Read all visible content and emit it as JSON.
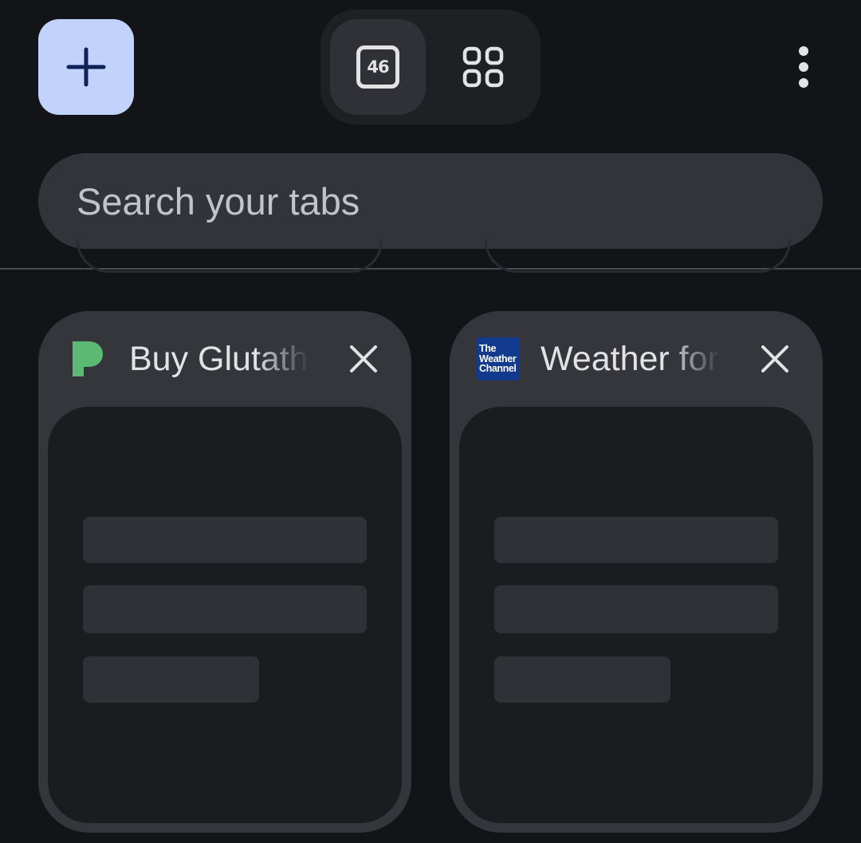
{
  "toolbar": {
    "new_tab_icon": "plus-icon",
    "tab_count": "46",
    "tab_groups_icon": "grid-icon",
    "menu_icon": "more-vertical-icon"
  },
  "search": {
    "placeholder": "Search your tabs",
    "value": ""
  },
  "tabs": [
    {
      "title": "Buy Glutathione",
      "favicon": "p-logo-icon",
      "favicon_color": "#5bb974"
    },
    {
      "title": "Weather forecast",
      "favicon": "weather-channel-icon",
      "favicon_lines": [
        "The",
        "Weather",
        "Channel"
      ],
      "favicon_color": "#123a8e"
    }
  ],
  "colors": {
    "background": "#131418",
    "accent": "#c2d3fb",
    "surface": "#35363b"
  }
}
